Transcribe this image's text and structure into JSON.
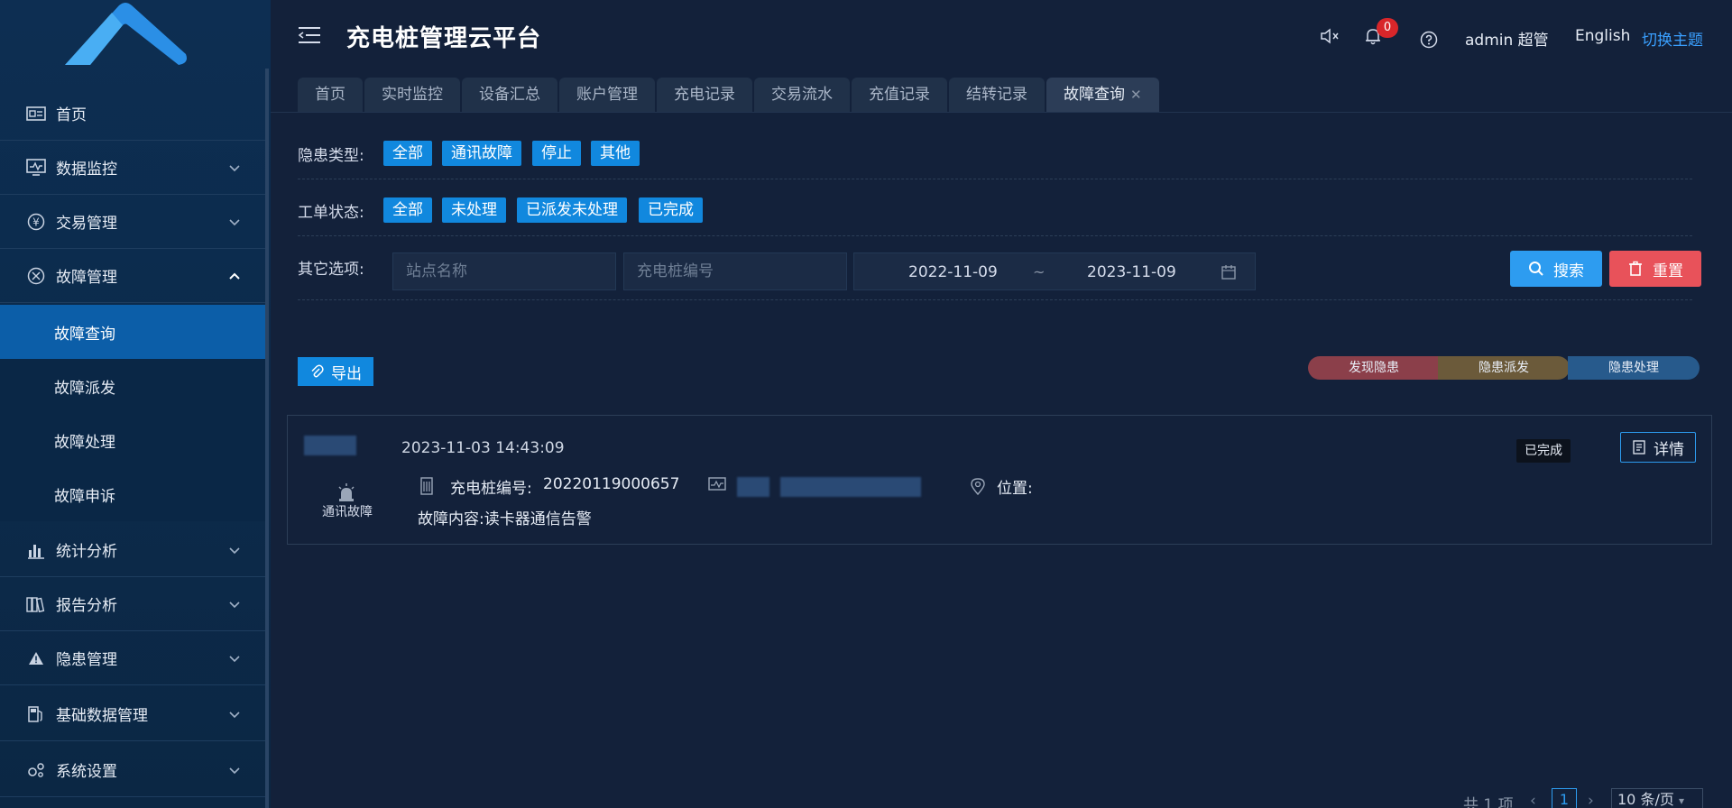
{
  "header": {
    "title": "充电桩管理云平台",
    "notification_count": "0",
    "user": "admin 超管",
    "language": "English",
    "switch_theme": "切换主题"
  },
  "sidebar": {
    "items": [
      {
        "label": "首页"
      },
      {
        "label": "数据监控"
      },
      {
        "label": "交易管理"
      },
      {
        "label": "故障管理"
      },
      {
        "label": "统计分析"
      },
      {
        "label": "报告分析"
      },
      {
        "label": "隐患管理"
      },
      {
        "label": "基础数据管理"
      },
      {
        "label": "系统设置"
      }
    ],
    "sub_items": [
      {
        "label": "故障查询"
      },
      {
        "label": "故障派发"
      },
      {
        "label": "故障处理"
      },
      {
        "label": "故障申诉"
      }
    ]
  },
  "tabs": [
    {
      "label": "首页"
    },
    {
      "label": "实时监控"
    },
    {
      "label": "设备汇总"
    },
    {
      "label": "账户管理"
    },
    {
      "label": "充电记录"
    },
    {
      "label": "交易流水"
    },
    {
      "label": "充值记录"
    },
    {
      "label": "结转记录"
    },
    {
      "label": "故障查询"
    }
  ],
  "filters": {
    "hazard_type_label": "隐患类型:",
    "hazard_types": [
      "全部",
      "通讯故障",
      "停止",
      "其他"
    ],
    "order_status_label": "工单状态:",
    "order_statuses": [
      "全部",
      "未处理",
      "已派发未处理",
      "已完成"
    ],
    "other_label": "其它选项:",
    "station_placeholder": "站点名称",
    "pile_placeholder": "充电桩编号",
    "date_start": "2022-11-09",
    "date_sep": "~",
    "date_end": "2023-11-09",
    "search_label": "搜索",
    "reset_label": "重置"
  },
  "export_label": "导出",
  "legend": [
    "发现隐患",
    "隐患派发",
    "隐患处理"
  ],
  "record": {
    "time": "2023-11-03 14:43:09",
    "type": "通讯故障",
    "pile_label": "充电桩编号:",
    "pile_no": "20220119000657",
    "location_label": "位置:",
    "content": "故障内容:读卡器通信告警",
    "status": "已完成",
    "detail_label": "详情"
  },
  "pagination": {
    "total": "共 1 项",
    "current": "1",
    "page_size": "10 条/页"
  },
  "colors": {
    "primary": "#1188de",
    "search": "#2d9cf0",
    "reset": "#e8525a",
    "accent_link": "#3aa0ff"
  }
}
